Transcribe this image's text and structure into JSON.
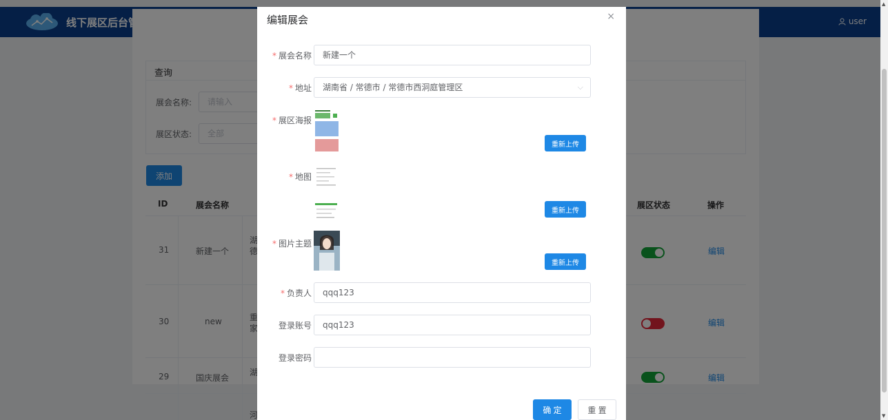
{
  "header": {
    "title": "线下展区后台管理系统",
    "user": "user"
  },
  "query": {
    "heading": "查询",
    "name_label": "展会名称:",
    "name_placeholder": "请输入",
    "status_label": "展区状态:",
    "status_value": "全部"
  },
  "add_label": "添加",
  "table": {
    "headers": {
      "id": "ID",
      "name": "展会名称",
      "status": "展区状态",
      "action": "操作"
    },
    "rows": [
      {
        "id": "31",
        "name": "新建一个",
        "addr": [
          "湖",
          "德"
        ],
        "status_on": true,
        "action": "编辑"
      },
      {
        "id": "30",
        "name": "new",
        "addr": [
          "重",
          "家"
        ],
        "status_on": false,
        "action": "编辑"
      },
      {
        "id": "29",
        "name": "国庆展会",
        "addr": [
          "湖"
        ],
        "status_on": true,
        "action": "编辑"
      },
      {
        "id": "",
        "name": "",
        "addr": [
          "河"
        ],
        "status_on": null,
        "action": ""
      }
    ]
  },
  "dialog": {
    "title": "编辑展会",
    "close": "×",
    "required_mark": "*",
    "fields": {
      "name": {
        "label": "展会名称",
        "value": "新建一个"
      },
      "address": {
        "label": "地址",
        "value": "湖南省 / 常德市 / 常德市西洞庭管理区"
      },
      "poster": {
        "label": "展区海报",
        "button": "重新上传"
      },
      "map": {
        "label": "地图",
        "button": "重新上传"
      },
      "theme": {
        "label": "图片主题",
        "button": "重新上传"
      },
      "owner": {
        "label": "负责人",
        "value": "qqq123"
      },
      "account": {
        "label": "登录账号",
        "value": "qqq123"
      },
      "password": {
        "label": "登录密码",
        "value": ""
      }
    },
    "confirm": "确 定",
    "reset": "重 置"
  },
  "colors": {
    "header": "#0a3f8c",
    "primary": "#1e88e5",
    "switch_on": "#13a538",
    "switch_off": "#e5283a"
  },
  "icons": {
    "user": "user-icon",
    "close": "close-icon",
    "select": "chevron-down-icon"
  }
}
